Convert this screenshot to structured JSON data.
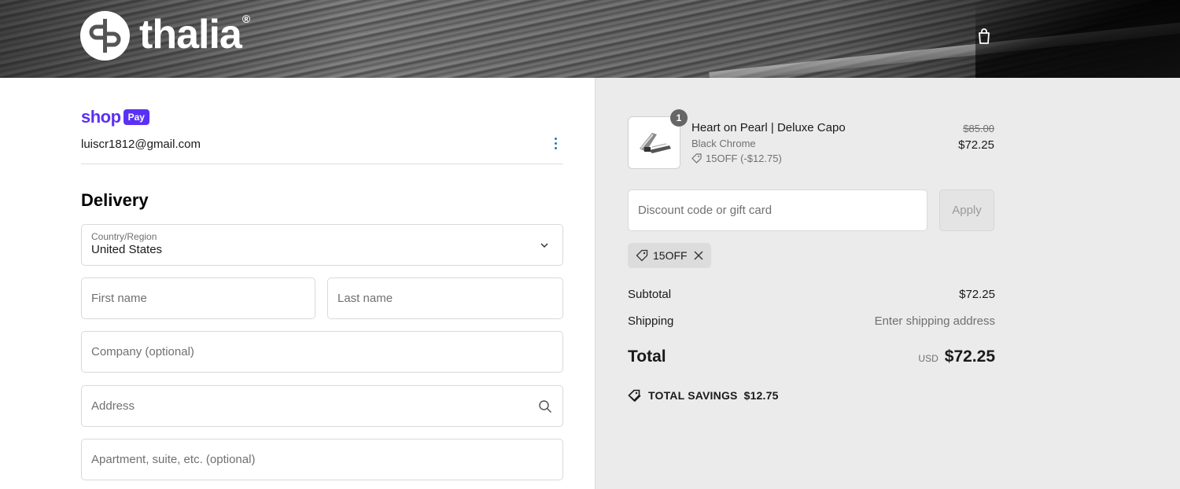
{
  "header": {
    "brand": "thalia",
    "reg_mark": "®",
    "cart_icon": "shopping-bag-icon"
  },
  "account": {
    "shop_word": "shop",
    "pay_badge": "Pay",
    "email": "luiscr1812@gmail.com",
    "menu_icon": "kebab-menu-icon"
  },
  "delivery": {
    "title": "Delivery",
    "country_label": "Country/Region",
    "country_value": "United States",
    "first_name_placeholder": "First name",
    "last_name_placeholder": "Last name",
    "company_placeholder": "Company (optional)",
    "address_placeholder": "Address",
    "apartment_placeholder": "Apartment, suite, etc. (optional)"
  },
  "order": {
    "item": {
      "quantity": "1",
      "name": "Heart on Pearl | Deluxe Capo",
      "variant": "Black Chrome",
      "discount": "15OFF (-$12.75)",
      "original_price": "$85.00",
      "price": "$72.25"
    },
    "discount_placeholder": "Discount code or gift card",
    "apply_label": "Apply",
    "applied_code": "15OFF",
    "subtotal_label": "Subtotal",
    "subtotal_value": "$72.25",
    "shipping_label": "Shipping",
    "shipping_value": "Enter shipping address",
    "total_label": "Total",
    "currency": "USD",
    "total_value": "$72.25",
    "savings_label": "TOTAL SAVINGS",
    "savings_value": "$12.75"
  },
  "colors": {
    "shop_pay_purple": "#5a31f4",
    "accent_blue": "#197bbd",
    "summary_bg": "#ebebeb"
  }
}
